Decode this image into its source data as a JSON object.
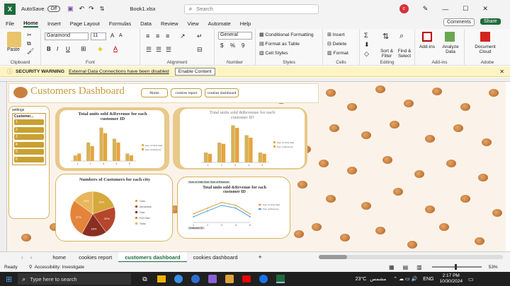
{
  "titlebar": {
    "autosave": "AutoSave",
    "autosave_state": "Off",
    "filename": "Book1.xlsx",
    "search_placeholder": "Search",
    "avatar_initial": "c"
  },
  "menu": [
    "File",
    "Home",
    "Insert",
    "Page Layout",
    "Formulas",
    "Data",
    "Review",
    "View",
    "Automate",
    "Help"
  ],
  "menu_active": "Home",
  "menu_right": {
    "comments": "Comments",
    "share": "Share"
  },
  "ribbon": {
    "paste": "Paste",
    "clipboard": "Clipboard",
    "font_name": "Garamond",
    "font_size": "11",
    "font": "Font",
    "alignment": "Alignment",
    "number_format": "General",
    "number": "Number",
    "cond_format": "Conditional Formatting",
    "format_table": "Format as Table",
    "cell_styles": "Cell Styles",
    "styles": "Styles",
    "insert": "Insert",
    "delete": "Delete",
    "format": "Format",
    "cells": "Cells",
    "sort_filter": "Sort & Filter",
    "find_select": "Find & Select",
    "editing": "Editing",
    "addins": "Add-ins",
    "analyze": "Analyze Data",
    "document_cloud": "Document Cloud",
    "adobe": "Adobe"
  },
  "warning": {
    "title": "SECURITY WARNING",
    "message": "External Data Connections have been disabled",
    "button": "Enable Content"
  },
  "dashboard": {
    "title": "Customers Dashboard",
    "nav_home": "Home",
    "nav_report": "cookies report",
    "nav_dashboard": "cookies dashboard",
    "slicer_title": "settings",
    "slicer_header": "Customer...",
    "slicer_items": [
      "1",
      "2",
      "3",
      "4",
      "5",
      "6"
    ]
  },
  "chart_data": [
    {
      "type": "bar",
      "title": "Total units sold &Revenue for each customer ID",
      "categories": [
        "1",
        "2",
        "3",
        "4",
        "5"
      ],
      "series": [
        {
          "name": "Sum of Units Sold",
          "values": [
            3,
            10,
            18,
            12,
            4
          ]
        },
        {
          "name": "Sum of Revenue",
          "values": [
            4,
            8,
            15,
            10,
            3
          ]
        }
      ]
    },
    {
      "type": "bar",
      "title": "Total units sold &Revenue for each customer ID",
      "categories": [
        "1",
        "2",
        "3",
        "4",
        "5"
      ],
      "series": [
        {
          "name": "Sum of Units Sold",
          "values": [
            40000,
            80000,
            150000,
            110000,
            40000
          ]
        },
        {
          "name": "Sum of Revenue",
          "values": [
            35000,
            75000,
            140000,
            100000,
            35000
          ]
        }
      ],
      "ylim": [
        0,
        160000
      ]
    },
    {
      "type": "pie",
      "title": "Numbers of Customers for each city",
      "series": [
        {
          "name": "Customers",
          "values": [
            20,
            20,
            18,
            27,
            15
          ]
        }
      ],
      "categories": [
        "Cairo",
        "Alexandria",
        "Giza",
        "Port Said",
        "Tanta"
      ],
      "labels": [
        "20%",
        "20%",
        "18%",
        "27%",
        "15%"
      ]
    },
    {
      "type": "line",
      "title": "Total units sold &Revenue for each customer ID",
      "categories": [
        "1",
        "2",
        "3",
        "4",
        "5"
      ],
      "series": [
        {
          "name": "Sum of Units Sold",
          "values": [
            3,
            5,
            7,
            6,
            3
          ]
        },
        {
          "name": "Sum of Revenue",
          "values": [
            2,
            4,
            6,
            5,
            2
          ]
        }
      ],
      "filters": [
        "Sum of Units Sold",
        "Sum of Revenue"
      ],
      "axis_filter": "Customer ID"
    }
  ],
  "sheet_tabs": [
    "home",
    "cookies report",
    "customers dashboard",
    "cookies dashboard"
  ],
  "active_tab": "customers dashboard",
  "status": {
    "ready": "Ready",
    "accessibility": "Accessibility: Investigate",
    "zoom": "53%"
  },
  "taskbar": {
    "search": "Type here to search",
    "weather": "23°C",
    "weather_desc": "مشمس",
    "lang": "ENG",
    "time": "2:17 PM",
    "date": "10/30/2024"
  },
  "colors": {
    "excel_green": "#1e6b3c",
    "gold": "#d7b35a",
    "bar_orange": "#e8a33c",
    "bar_gold": "#d4b35c"
  }
}
